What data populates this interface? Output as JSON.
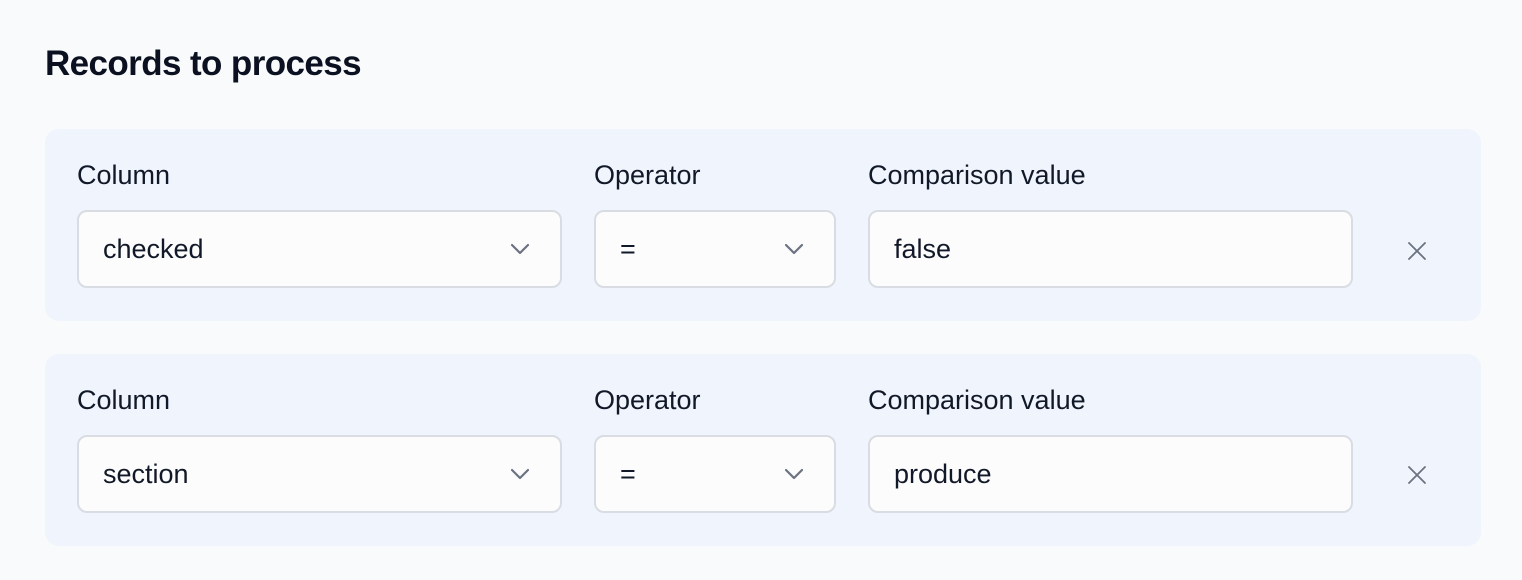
{
  "section": {
    "title": "Records to process"
  },
  "filters": [
    {
      "column_label": "Column",
      "column_value": "checked",
      "operator_label": "Operator",
      "operator_value": "=",
      "comparison_label": "Comparison value",
      "comparison_value": "false",
      "remove_icon": "close-icon"
    },
    {
      "column_label": "Column",
      "column_value": "section",
      "operator_label": "Operator",
      "operator_value": "=",
      "comparison_label": "Comparison value",
      "comparison_value": "produce",
      "remove_icon": "close-icon"
    }
  ],
  "colors": {
    "row_background": "#eff4fd",
    "input_background": "#fcfcfd",
    "input_border": "#d9dde3",
    "icon": "#6b7280"
  }
}
